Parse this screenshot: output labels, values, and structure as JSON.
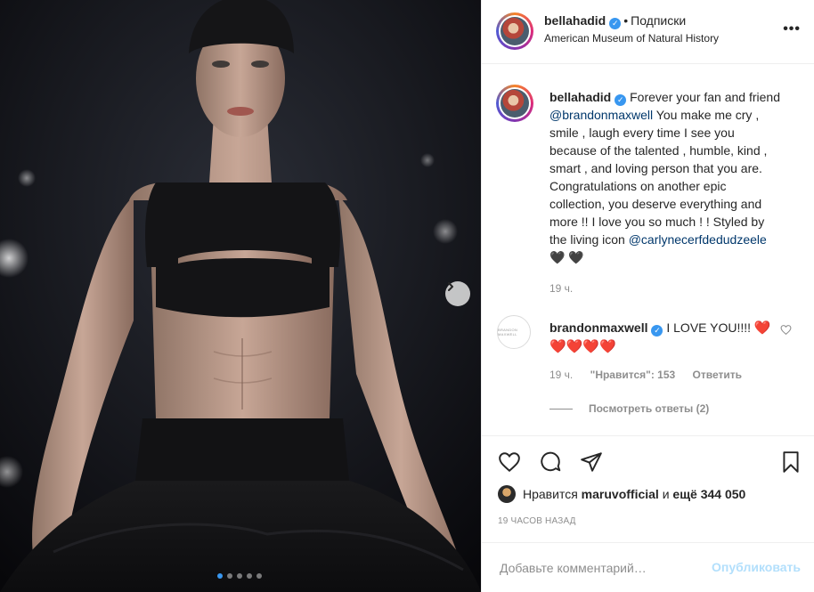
{
  "post": {
    "username": "bellahadid",
    "follow_label": "Подписки",
    "location": "American Museum of Natural History",
    "more_label": "•••"
  },
  "caption": {
    "username": "bellahadid",
    "text_1": "Forever your fan and friend ",
    "mention_1": "@brandonmaxwell",
    "text_2": " You make me cry , smile , laugh every time I see you because of the talented , humble, kind , smart , and loving person that you are. Congratulations on another epic collection, you deserve everything and more !! I love you so much ! ! Styled by the living icon ",
    "mention_2": "@carlynecerfdedudzeele",
    "emoji": "🖤 🖤",
    "time": "19 ч."
  },
  "comment": {
    "avatar_text": "BRANDON MAXWELL",
    "username": "brandonmaxwell",
    "text": "I LOVE YOU!!!!",
    "hearts": "❤️❤️❤️❤️❤️",
    "time": "19 ч.",
    "likes": "\"Нравится\": 153",
    "reply_label": "Ответить",
    "view_replies": "Посмотреть ответы (2)"
  },
  "likes_line": {
    "prefix": "Нравится",
    "user": "maruvofficial",
    "middle": "и",
    "others": "ещё 344 050"
  },
  "timestamp": "19 ЧАСОВ НАЗАД",
  "add_comment": {
    "placeholder": "Добавьте комментарий…",
    "publish_label": "Опубликовать"
  },
  "carousel": {
    "count": 5,
    "active": 0
  },
  "colors": {
    "verified": "#3897f0",
    "mention": "#00376b",
    "secondary_text": "#8e8e8e",
    "publish_disabled": "#b2dffc",
    "heart_red": "#ed4956"
  }
}
